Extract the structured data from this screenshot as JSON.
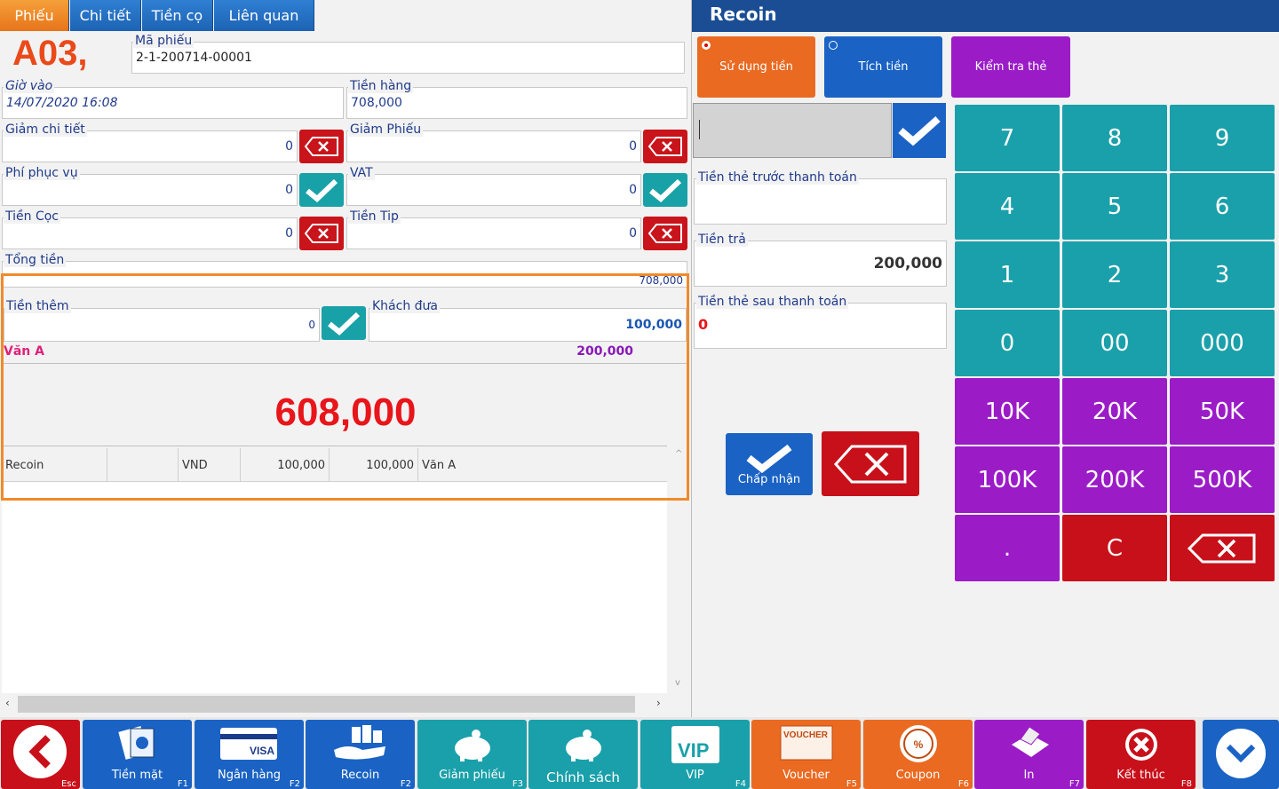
{
  "tabs": [
    "Phiếu",
    "Chi tiết",
    "Tiền cọ",
    "Liên quan"
  ],
  "ticket": {
    "table_code": "A03,",
    "code_label": "Mã phiếu",
    "code_value": "2-1-200714-00001",
    "checkin_label": "Giờ vào",
    "checkin_value": "14/07/2020 16:08",
    "goods_label": "Tiền hàng",
    "goods_value": "708,000",
    "detail_disc_label": "Giảm chi tiết",
    "detail_disc_value": "0",
    "ticket_disc_label": "Giảm Phiếu",
    "ticket_disc_value": "0",
    "service_label": "Phí phục vụ",
    "service_value": "0",
    "vat_label": "VAT",
    "vat_value": "0",
    "deposit_label": "Tiền Cọc",
    "deposit_value": "0",
    "tip_label": "Tiền Tip",
    "tip_value": "0",
    "total_label": "Tổng tiền",
    "total_value": "708,000",
    "extra_label": "Tiền thêm",
    "extra_value": "0",
    "given_label": "Khách đưa",
    "given_value": "100,000",
    "customer_name": "Văn A",
    "customer_amount": "200,000",
    "due": "608,000"
  },
  "payments": [
    {
      "method": "Recoin",
      "blank": "",
      "currency": "VND",
      "amount": "100,000",
      "converted": "100,000",
      "customer": "Văn A"
    }
  ],
  "panel": {
    "title": "Recoin",
    "use_money": "Sử dụng tiền",
    "accumulate": "Tích tiền",
    "check_card": "Kiểm tra thẻ",
    "input_value": "",
    "before_label": "Tiền thẻ trước thanh toán",
    "before_value": "",
    "pay_label": "Tiền trả",
    "pay_value": "200,000",
    "after_label": "Tiền thẻ sau thanh toán",
    "after_value": "0",
    "accept": "Chấp nhận"
  },
  "keypad": [
    "7",
    "8",
    "9",
    "4",
    "5",
    "6",
    "1",
    "2",
    "3",
    "0",
    "00",
    "000",
    "10K",
    "20K",
    "50K",
    "100K",
    "200K",
    "500K",
    ".",
    "C",
    ""
  ],
  "footer": [
    {
      "label": "",
      "key": "Esc"
    },
    {
      "label": "Tiền mặt",
      "key": "F1"
    },
    {
      "label": "Ngân hàng",
      "key": "F2"
    },
    {
      "label": "Recoin",
      "key": "F2"
    },
    {
      "label": "Giảm phiếu",
      "key": "F3"
    },
    {
      "label": "Chính sách",
      "key": ""
    },
    {
      "label": "VIP",
      "key": "F4"
    },
    {
      "label": "Voucher",
      "key": "F5"
    },
    {
      "label": "Coupon",
      "key": "F6"
    },
    {
      "label": "In",
      "key": "F7"
    },
    {
      "label": "Kết thúc",
      "key": "F8"
    },
    {
      "label": "",
      "key": ""
    }
  ],
  "colors": {
    "accent": "#ea6a22",
    "blue": "#1a63c4",
    "teal": "#1aa0aa",
    "purple": "#9b1cc7",
    "red": "#c8101a"
  }
}
